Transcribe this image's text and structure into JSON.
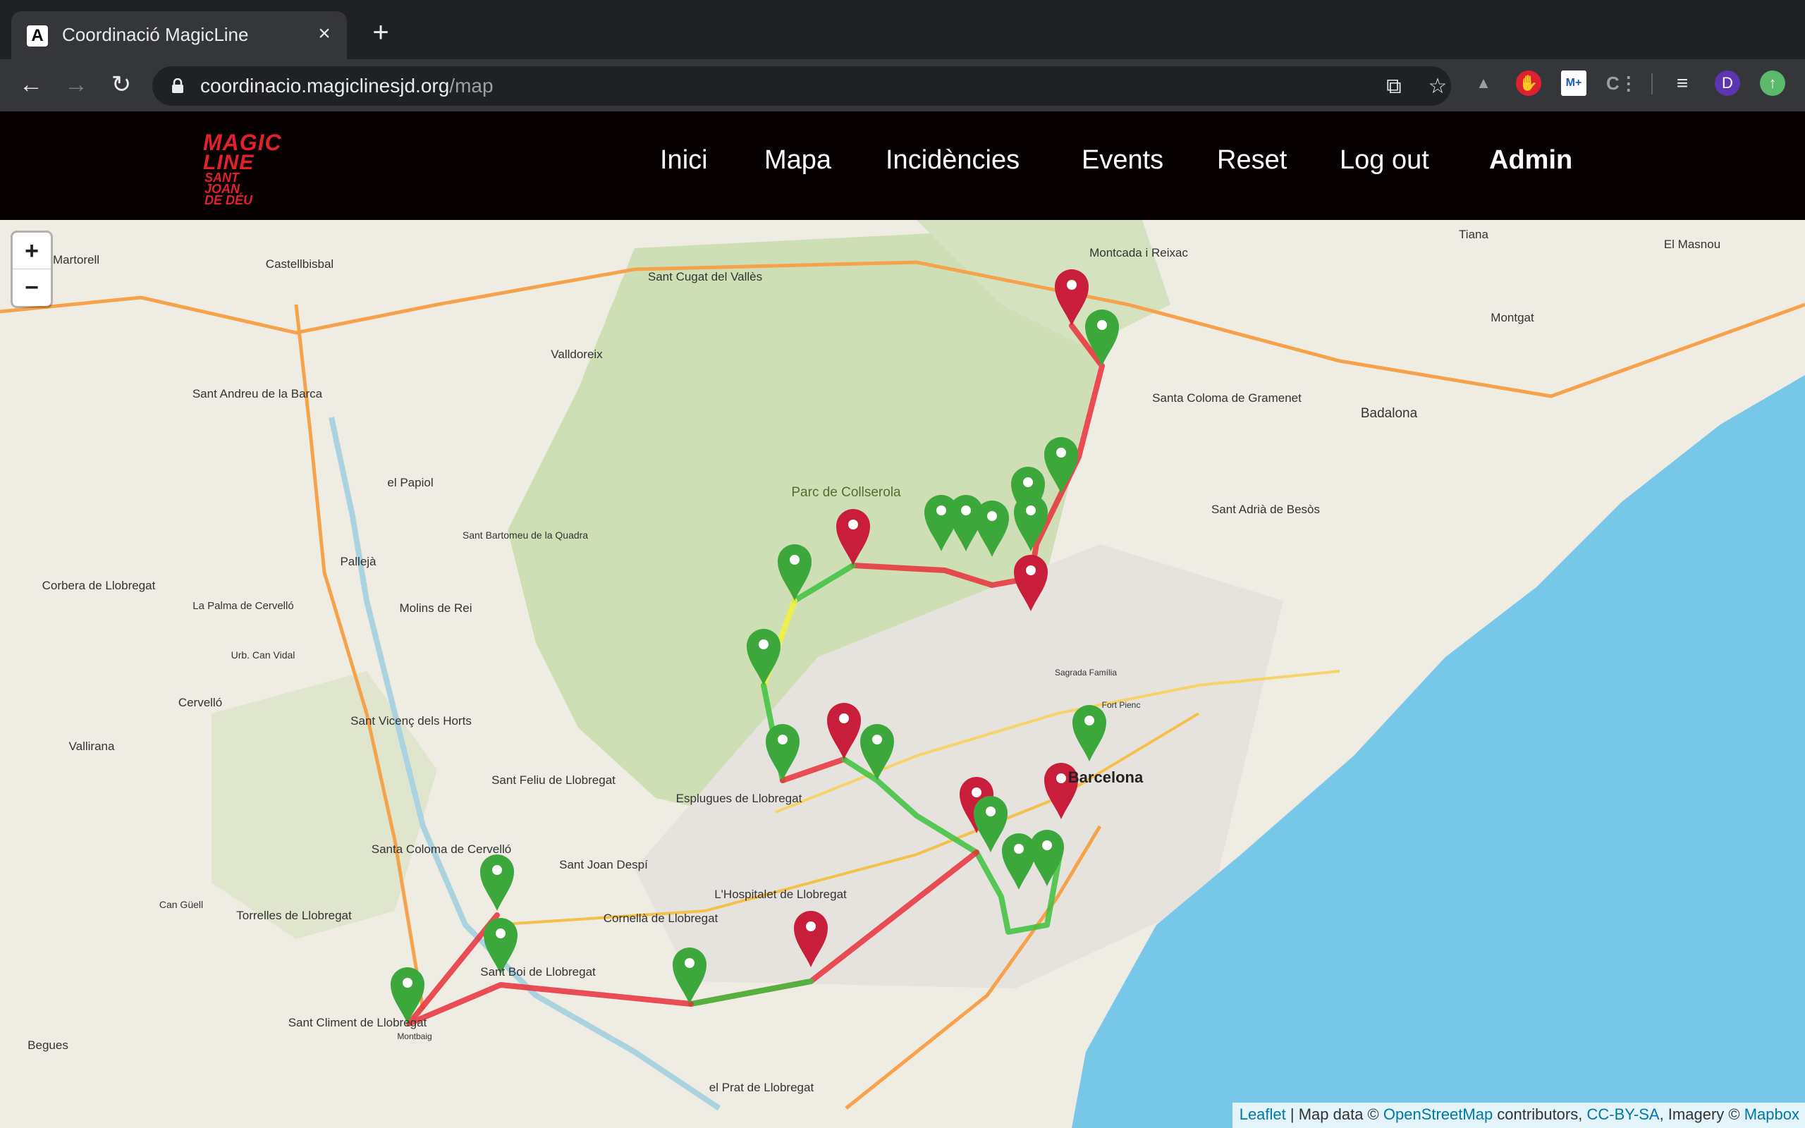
{
  "browser": {
    "tab_title": "Coordinació MagicLine",
    "tab_favicon": "A",
    "url_host": "coordinacio.magiclinesjd.org",
    "url_path": "/map",
    "profile_initial": "D"
  },
  "site": {
    "logo_line1": "MAGIC",
    "logo_line2": "LINE",
    "logo_line3": "SANT JOAN",
    "logo_line4": "DE DÉU",
    "nav": [
      "Inici",
      "Mapa",
      "Incidències",
      "Events",
      "Reset",
      "Log out",
      "Admin"
    ]
  },
  "map": {
    "zoom_in": "+",
    "zoom_out": "−",
    "attribution": {
      "leaflet": "Leaflet",
      "mapdata": " | Map data © ",
      "osm": "OpenStreetMap",
      "contributors": " contributors, ",
      "ccbysa": "CC-BY-SA",
      "imagery": ", Imagery © ",
      "mapbox": "Mapbox"
    },
    "places": [
      "Martorell",
      "Castellbisbal",
      "Sant Cugat del Vallès",
      "Montcada i Reixac",
      "Tiana",
      "El Masnou",
      "Montgat",
      "Badalona",
      "Santa Coloma de Gramenet",
      "Sant Adrià de Besòs",
      "Valldoreix",
      "Sant Andreu de la Barca",
      "el Papiol",
      "Parc de Collserola",
      "Pallejà",
      "Corbera de Llobregat",
      "La Palma de Cervelló",
      "Molins de Rei",
      "Cervelló",
      "Vallirana",
      "Sant Vicenç dels Horts",
      "Sant Feliu de Llobregat",
      "Esplugues de Llobregat",
      "Barcelona",
      "Santa Coloma de Cervelló",
      "Sant Joan Despí",
      "L'Hospitalet de Llobregat",
      "Cornellà de Llobregat",
      "Torrelles de Llobregat",
      "Sant Boi de Llobregat",
      "Sant Climent de Llobregat",
      "el Prat de Llobregat",
      "Begues",
      "Sant Bartomeu de la Quadra",
      "Urb. Can Vidal",
      "Sagrada Família",
      "Fort Pienc",
      "Can Güell",
      "Montbaig"
    ]
  }
}
